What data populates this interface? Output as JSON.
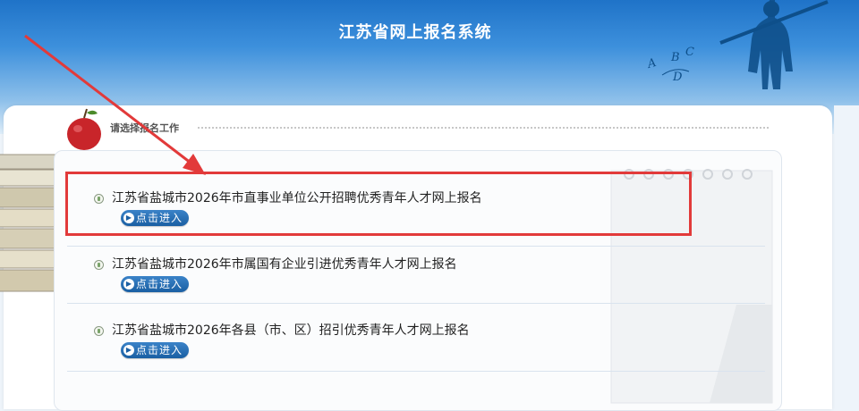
{
  "header": {
    "title": "江苏省网上报名系统"
  },
  "section": {
    "label": "请选择报名工作"
  },
  "jobs": [
    {
      "title": "江苏省盐城市2026年市直事业单位公开招聘优秀青年人才网上报名",
      "button_label": "点击进入"
    },
    {
      "title": "江苏省盐城市2026年市属国有企业引进优秀青年人才网上报名",
      "button_label": "点击进入"
    },
    {
      "title": "江苏省盐城市2026年各县（市、区）招引优秀青年人才网上报名",
      "button_label": "点击进入"
    }
  ],
  "colors": {
    "banner": "#2f86d6",
    "button": "#1a5fa3",
    "highlight": "#e23a3a"
  }
}
